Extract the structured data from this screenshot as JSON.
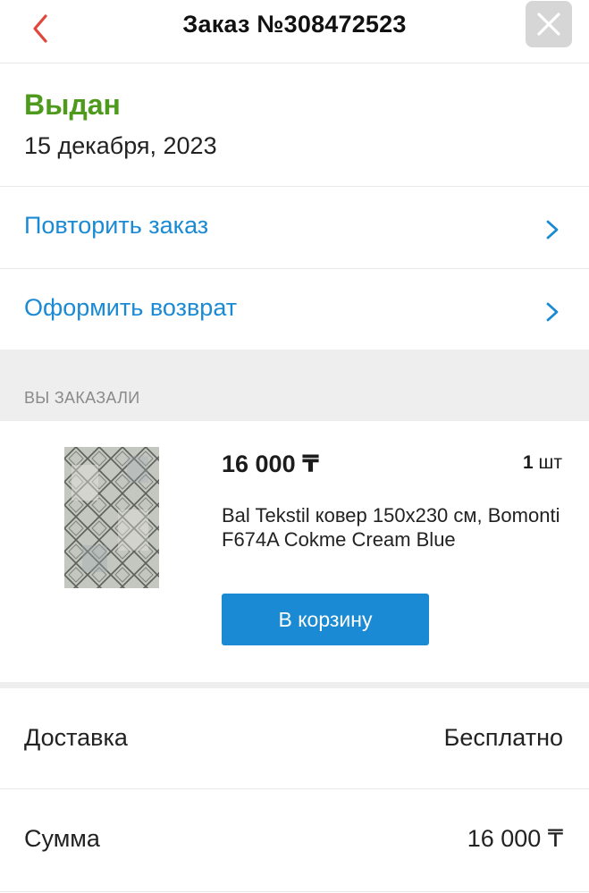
{
  "header": {
    "title": "Заказ №308472523",
    "back_icon": "chevron-left-icon",
    "close_icon": "close-icon"
  },
  "order": {
    "status": "Выдан",
    "date": "15 декабря, 2023"
  },
  "actions": [
    {
      "label": "Повторить заказ"
    },
    {
      "label": "Оформить возврат"
    }
  ],
  "section": {
    "label": "ВЫ ЗАКАЗАЛИ"
  },
  "product": {
    "price": "16 000 ₸",
    "qty_number": "1",
    "qty_unit": "шт",
    "name": "Bal Tekstil ковер 150x230 см, Bomonti F674A Cokme Cream Blue",
    "cart_label": "В корзину"
  },
  "summary": {
    "delivery_label": "Доставка",
    "delivery_value": "Бесплатно",
    "total_label": "Сумма",
    "total_value": "16 000 ₸"
  },
  "colors": {
    "accent": "#1a8ad4",
    "status_green": "#4e9a1d",
    "back_red": "#e0473a",
    "section_bg": "#eeeeee",
    "close_bg": "#d6d6d6"
  }
}
